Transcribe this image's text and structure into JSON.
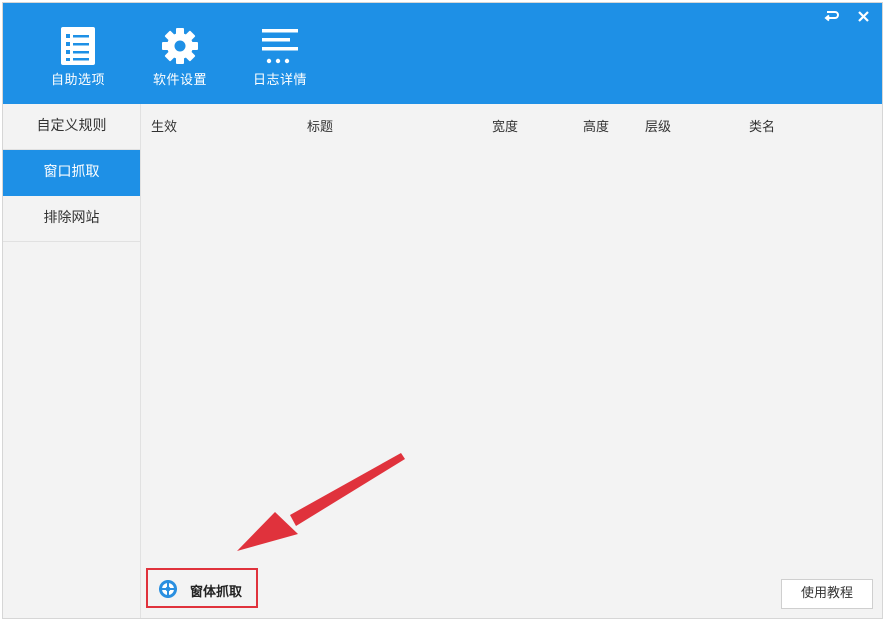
{
  "toolbar": {
    "items": [
      {
        "label": "自助选项",
        "icon": "checklist-icon"
      },
      {
        "label": "软件设置",
        "icon": "gear-icon"
      },
      {
        "label": "日志详情",
        "icon": "log-lines-icon"
      }
    ]
  },
  "window_controls": {
    "restore_icon": "restore-icon",
    "close_icon": "close-icon"
  },
  "sidebar": {
    "items": [
      {
        "label": "自定义规则",
        "active": false
      },
      {
        "label": "窗口抓取",
        "active": true
      },
      {
        "label": "排除网站",
        "active": false
      }
    ]
  },
  "table": {
    "columns": [
      "生效",
      "标题",
      "宽度",
      "高度",
      "层级",
      "类名"
    ],
    "rows": []
  },
  "footer": {
    "capture_label": "窗体抓取",
    "tutorial_label": "使用教程"
  },
  "colors": {
    "primary": "#1e90e6",
    "highlight_border": "#e0323c",
    "arrow": "#e0323c",
    "background": "#f3f3f3"
  }
}
